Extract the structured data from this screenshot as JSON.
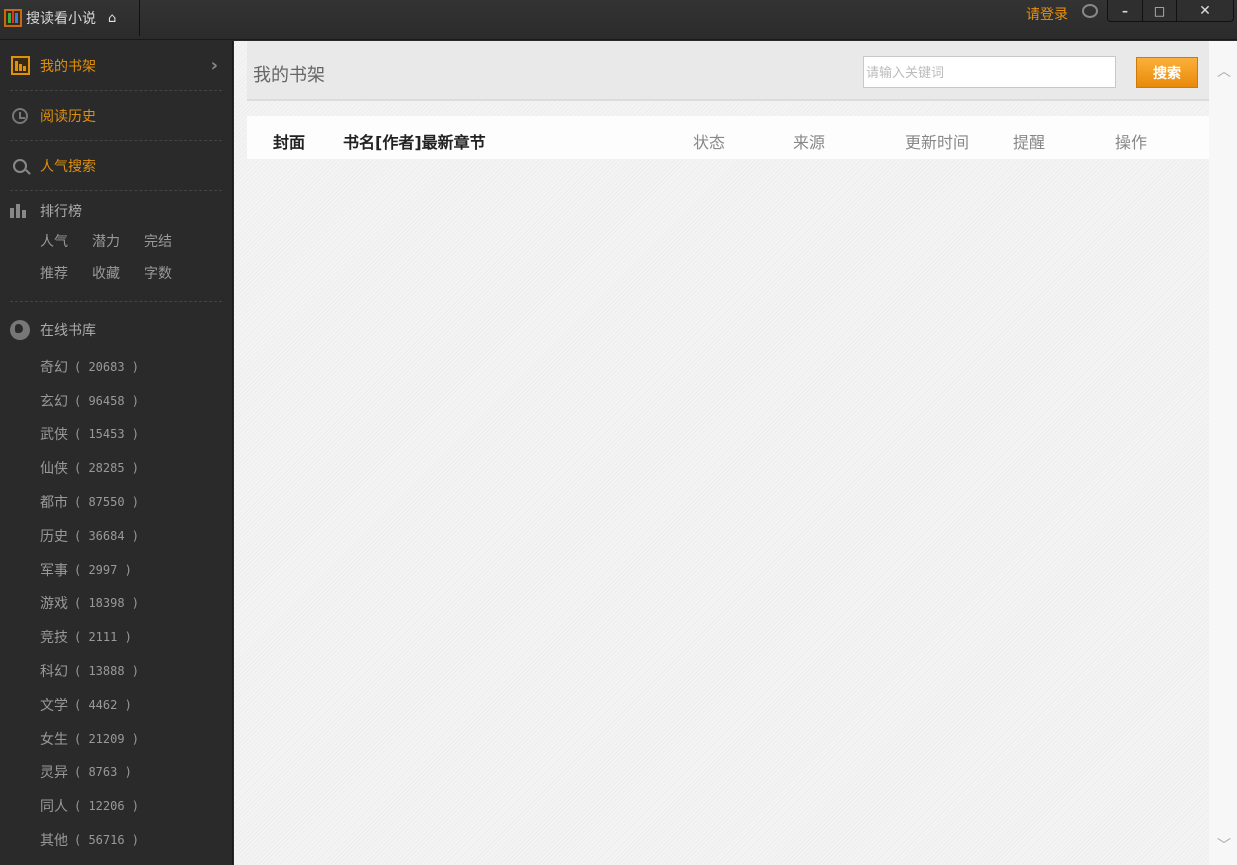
{
  "titlebar": {
    "app_name": "搜读看小说",
    "login_label": "请登录",
    "minimize": "–",
    "maximize": "□",
    "close": "✕"
  },
  "sidebar": {
    "nav": [
      {
        "label": "我的书架",
        "icon": "bookshelf-icon",
        "active": true
      },
      {
        "label": "阅读历史",
        "icon": "clock-icon"
      },
      {
        "label": "人气搜索",
        "icon": "search-icon"
      }
    ],
    "ranking": {
      "title": "排行榜",
      "items": [
        "人气",
        "潜力",
        "完结",
        "推荐",
        "收藏",
        "字数"
      ]
    },
    "library": {
      "title": "在线书库",
      "categories": [
        {
          "name": "奇幻",
          "count": "( 20683 )"
        },
        {
          "name": "玄幻",
          "count": "( 96458 )"
        },
        {
          "name": "武侠",
          "count": "( 15453 )"
        },
        {
          "name": "仙侠",
          "count": "( 28285 )"
        },
        {
          "name": "都市",
          "count": "( 87550 )"
        },
        {
          "name": "历史",
          "count": "( 36684 )"
        },
        {
          "name": "军事",
          "count": "( 2997 )"
        },
        {
          "name": "游戏",
          "count": "( 18398 )"
        },
        {
          "name": "竞技",
          "count": "( 2111 )"
        },
        {
          "name": "科幻",
          "count": "( 13888 )"
        },
        {
          "name": "文学",
          "count": "( 4462 )"
        },
        {
          "name": "女生",
          "count": "( 21209 )"
        },
        {
          "name": "灵异",
          "count": "( 8763 )"
        },
        {
          "name": "同人",
          "count": "( 12206 )"
        },
        {
          "name": "其他",
          "count": "( 56716 )"
        }
      ]
    }
  },
  "main": {
    "title": "我的书架",
    "search": {
      "placeholder": "请输入关键词",
      "value": "",
      "button": "搜索"
    },
    "columns": [
      "封面",
      "书名[作者]最新章节",
      "状态",
      "来源",
      "更新时间",
      "提醒",
      "操作"
    ]
  },
  "colors": {
    "accent": "#e8900a",
    "sidebar_bg": "#2a2a2a"
  }
}
